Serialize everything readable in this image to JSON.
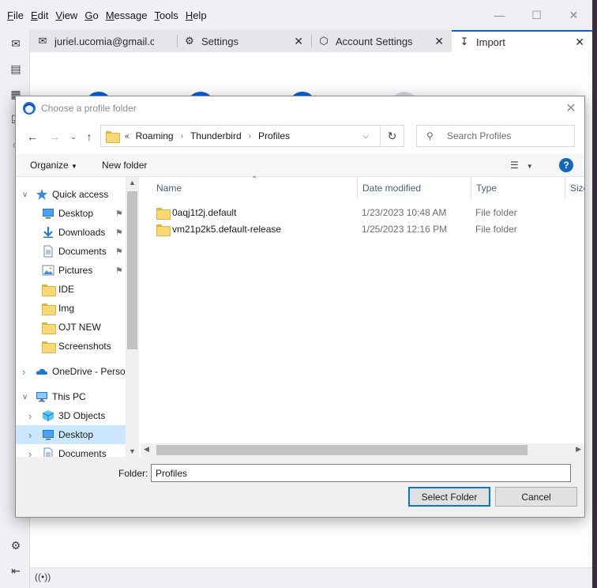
{
  "menubar": {
    "items": [
      "File",
      "Edit",
      "View",
      "Go",
      "Message",
      "Tools",
      "Help"
    ],
    "mnemonics": [
      "F",
      "E",
      "V",
      "G",
      "M",
      "T",
      "H"
    ]
  },
  "tabs": [
    {
      "label": "juriel.ucomia@gmail.com",
      "icon": "envelope-icon"
    },
    {
      "label": "Settings",
      "icon": "gear-icon"
    },
    {
      "label": "Account Settings",
      "icon": "account-settings-icon"
    },
    {
      "label": "Import",
      "icon": "import-icon",
      "selected": true
    }
  ],
  "dialog": {
    "title": "Choose a profile folder",
    "address": {
      "overflow": "«",
      "crumbs": [
        "Roaming",
        "Thunderbird",
        "Profiles"
      ]
    },
    "search_placeholder": "Search Profiles",
    "commands": {
      "organize": "Organize",
      "new_folder": "New folder"
    },
    "nav": [
      {
        "label": "Quick access",
        "icon": "star-icon",
        "level": 0,
        "expanded": true,
        "pinned": false
      },
      {
        "label": "Desktop",
        "icon": "desktop-icon",
        "level": 1,
        "pinned": true
      },
      {
        "label": "Downloads",
        "icon": "downloads-icon",
        "level": 1,
        "pinned": true
      },
      {
        "label": "Documents",
        "icon": "documents-icon",
        "level": 1,
        "pinned": true
      },
      {
        "label": "Pictures",
        "icon": "pictures-icon",
        "level": 1,
        "pinned": true
      },
      {
        "label": "IDE",
        "icon": "folder-icon",
        "level": 1,
        "pinned": false
      },
      {
        "label": "Img",
        "icon": "folder-icon",
        "level": 1,
        "pinned": false
      },
      {
        "label": "OJT NEW",
        "icon": "folder-icon",
        "level": 1,
        "pinned": false
      },
      {
        "label": "Screenshots",
        "icon": "folder-icon",
        "level": 1,
        "pinned": false
      },
      {
        "label": "OneDrive - Person",
        "icon": "onedrive-icon",
        "level": 0,
        "expanded": false
      },
      {
        "label": "This PC",
        "icon": "this-pc-icon",
        "level": 0,
        "expanded": true
      },
      {
        "label": "3D Objects",
        "icon": "3d-objects-icon",
        "level": 1,
        "expanded": false
      },
      {
        "label": "Desktop",
        "icon": "desktop-icon",
        "level": 1,
        "expanded": false,
        "selected": true
      },
      {
        "label": "Documents",
        "icon": "documents-icon",
        "level": 1,
        "expanded": false
      }
    ],
    "columns": {
      "name": "Name",
      "date": "Date modified",
      "type": "Type",
      "size": "Size"
    },
    "files": [
      {
        "name": "0aqj1t2j.default",
        "date": "1/23/2023 10:48 AM",
        "type": "File folder"
      },
      {
        "name": "vm21p2k5.default-release",
        "date": "1/25/2023 12:16 PM",
        "type": "File folder"
      }
    ],
    "folder_label": "Folder:",
    "folder_value": "Profiles",
    "select_button": "Select Folder",
    "cancel_button": "Cancel"
  },
  "colors": {
    "accent": "#0061e0",
    "selection": "#cce8ff",
    "folder": "#f8d775"
  }
}
